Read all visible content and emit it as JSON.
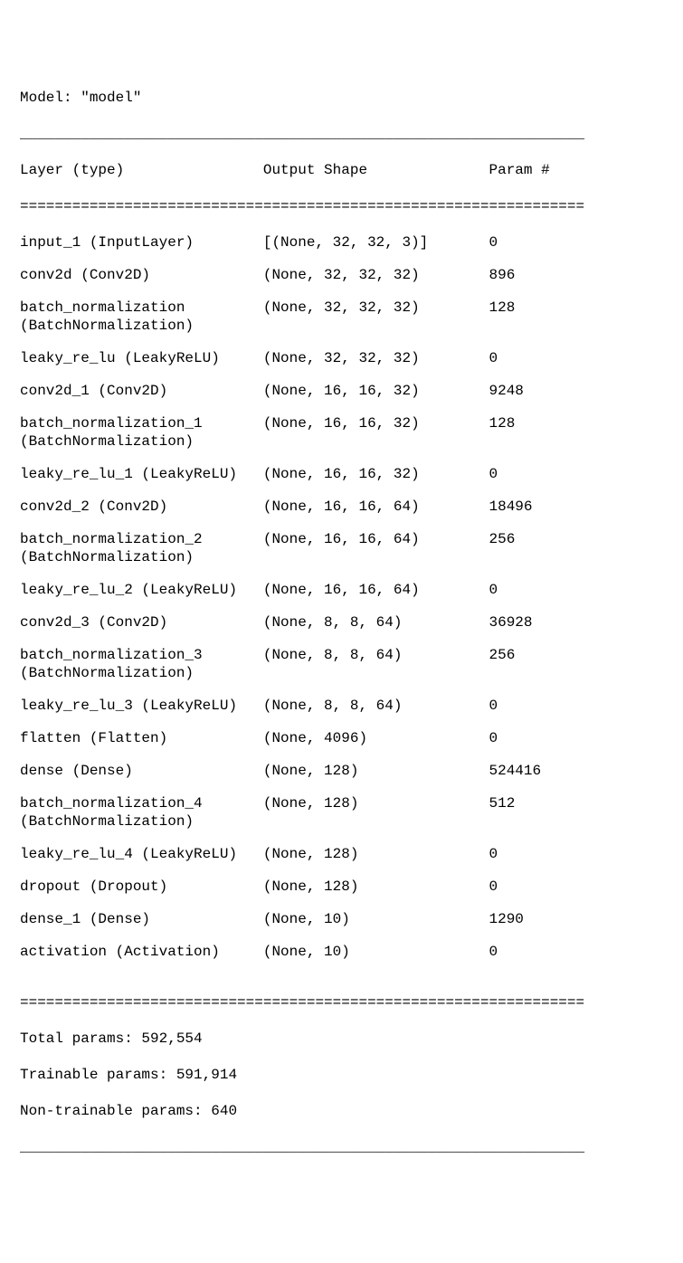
{
  "title": "Model: \"model\"",
  "hr_thin": "_________________________________________________________________",
  "hr_thick": "=================================================================",
  "headers": {
    "layer": "Layer (type)",
    "shape": "Output Shape",
    "param": "Param #"
  },
  "rows": [
    {
      "layer": "input_1 (InputLayer)",
      "shape": "[(None, 32, 32, 3)]",
      "param": "0"
    },
    {
      "layer": "conv2d (Conv2D)",
      "shape": "(None, 32, 32, 32)",
      "param": "896"
    },
    {
      "layer": "batch_normalization (BatchNormalization)",
      "shape": "(None, 32, 32, 32)",
      "param": "128"
    },
    {
      "layer": "leaky_re_lu (LeakyReLU)",
      "shape": "(None, 32, 32, 32)",
      "param": "0"
    },
    {
      "layer": "conv2d_1 (Conv2D)",
      "shape": "(None, 16, 16, 32)",
      "param": "9248"
    },
    {
      "layer": "batch_normalization_1 (BatchNormalization)",
      "shape": "(None, 16, 16, 32)",
      "param": "128"
    },
    {
      "layer": "leaky_re_lu_1 (LeakyReLU)",
      "shape": "(None, 16, 16, 32)",
      "param": "0"
    },
    {
      "layer": "conv2d_2 (Conv2D)",
      "shape": "(None, 16, 16, 64)",
      "param": "18496"
    },
    {
      "layer": "batch_normalization_2 (BatchNormalization)",
      "shape": "(None, 16, 16, 64)",
      "param": "256"
    },
    {
      "layer": "leaky_re_lu_2 (LeakyReLU)",
      "shape": "(None, 16, 16, 64)",
      "param": "0"
    },
    {
      "layer": "conv2d_3 (Conv2D)",
      "shape": "(None, 8, 8, 64)",
      "param": "36928"
    },
    {
      "layer": "batch_normalization_3 (BatchNormalization)",
      "shape": "(None, 8, 8, 64)",
      "param": "256"
    },
    {
      "layer": "leaky_re_lu_3 (LeakyReLU)",
      "shape": "(None, 8, 8, 64)",
      "param": "0"
    },
    {
      "layer": "flatten (Flatten)",
      "shape": "(None, 4096)",
      "param": "0"
    },
    {
      "layer": "dense (Dense)",
      "shape": "(None, 128)",
      "param": "524416"
    },
    {
      "layer": "batch_normalization_4 (BatchNormalization)",
      "shape": "(None, 128)",
      "param": "512"
    },
    {
      "layer": "leaky_re_lu_4 (LeakyReLU)",
      "shape": "(None, 128)",
      "param": "0"
    },
    {
      "layer": "dropout (Dropout)",
      "shape": "(None, 128)",
      "param": "0"
    },
    {
      "layer": "dense_1 (Dense)",
      "shape": "(None, 10)",
      "param": "1290"
    },
    {
      "layer": "activation (Activation)",
      "shape": "(None, 10)",
      "param": "0"
    }
  ],
  "totals": {
    "total": "Total params: 592,554",
    "trainable": "Trainable params: 591,914",
    "non_trainable": "Non-trainable params: 640"
  }
}
